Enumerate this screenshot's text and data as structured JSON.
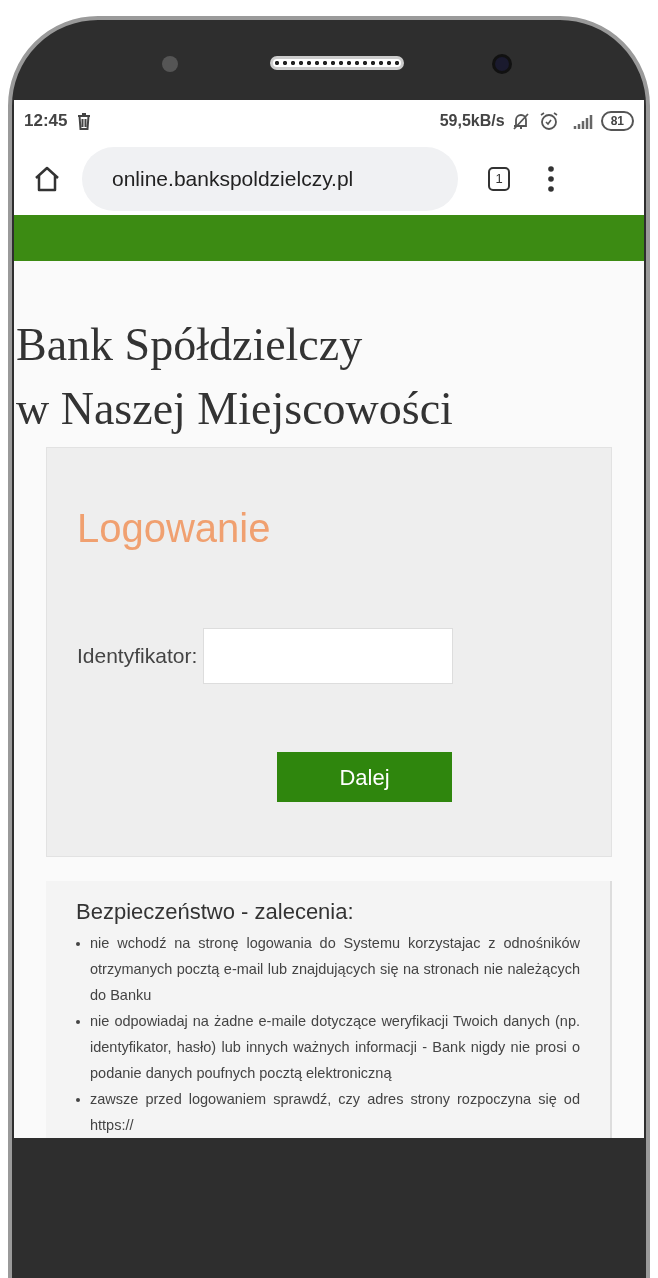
{
  "status_bar": {
    "time": "12:45",
    "speed": "59,5kB/s",
    "battery": "81"
  },
  "browser": {
    "url": "online.bankspoldzielczy.pl",
    "tab_count": "1"
  },
  "bank_name": [
    "Bank Spółdzielczy",
    "w Naszej Miejscowości"
  ],
  "login": {
    "title": "Logowanie",
    "field_label": "Identyfikator:",
    "button": "Dalej"
  },
  "security": {
    "title": "Bezpieczeństwo - zalecenia:",
    "items": [
      "nie wchodź na stronę logowania do Systemu korzystajac z odnośników otrzymanych pocztą e-mail lub znajdujących się na stronach nie należących do Banku",
      "nie odpowiadaj na żadne e-maile dotyczące weryfikacji Twoich danych (np. identyfikator, hasło) lub innych ważnych informacji - Bank nigdy nie prosi o podanie danych poufnych pocztą elektroniczną",
      "zawsze przed logowaniem sprawdź, czy adres strony rozpoczyna się od https://"
    ]
  }
}
